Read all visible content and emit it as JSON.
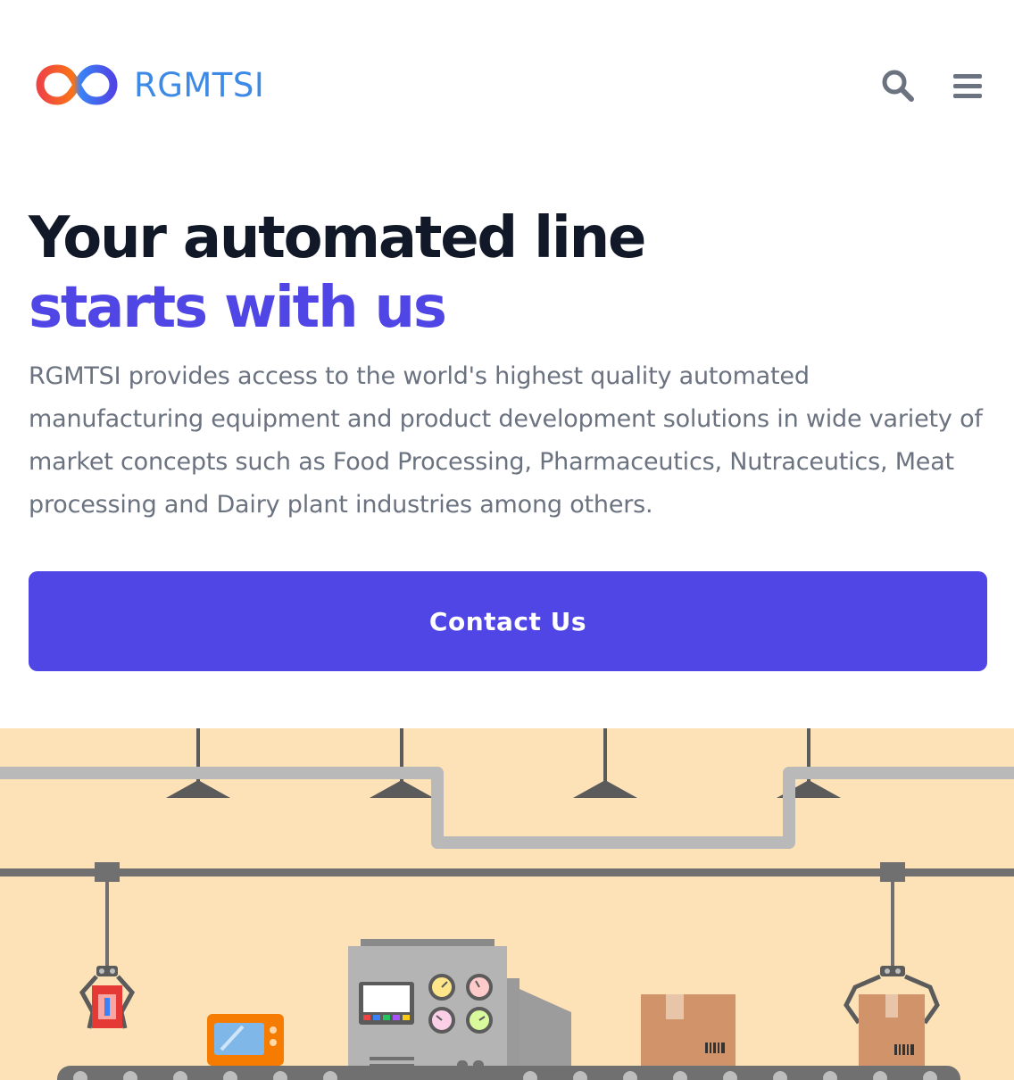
{
  "brand": {
    "name": "RGMTSI",
    "logo_icon": "infinity-logo-icon",
    "colors": {
      "brand_text": "#3d8ae6",
      "logo_gradient": [
        "#ef4444",
        "#f97316",
        "#3b82f6",
        "#4f46e5"
      ]
    }
  },
  "header": {
    "search_icon": "search-icon",
    "menu_icon": "hamburger-menu-icon",
    "icon_color": "#6b7280"
  },
  "hero": {
    "title_line1": "Your automated line",
    "title_line2": "starts with us",
    "description": "RGMTSI provides access to the world's highest quality automated manufacturing equipment and product development solutions in wide variety of market concepts such as Food Processing, Pharmaceutics, Nutraceutics, Meat processing and Dairy plant industries among others.",
    "cta_label": "Contact Us",
    "colors": {
      "title": "#111827",
      "accent": "#4f46e5",
      "body": "#6b7280",
      "cta_bg": "#4f46e5",
      "cta_text": "#ffffff"
    }
  },
  "illustration": {
    "subject": "factory-conveyor-illustration",
    "background": "#fde2b8"
  }
}
